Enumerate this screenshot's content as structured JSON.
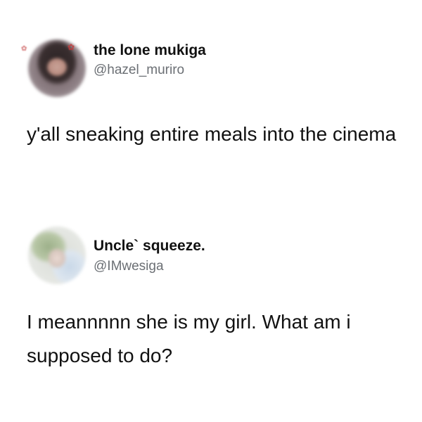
{
  "tweets": [
    {
      "display_name": "the lone mukiga",
      "handle": "@hazel_muriro",
      "text": "y'all sneaking entire meals into the cinema",
      "avatar_icon": "blurred-profile-photo"
    },
    {
      "display_name": "Uncle` squeeze.",
      "handle": "@IMwesiga",
      "text": "I meannnnn she is my girl. What am i supposed to do?",
      "avatar_icon": "blurred-profile-photo"
    }
  ],
  "colors": {
    "background": "#ffffff",
    "name_text": "#111111",
    "handle_text": "#6b6f74",
    "body_text": "#111111"
  }
}
